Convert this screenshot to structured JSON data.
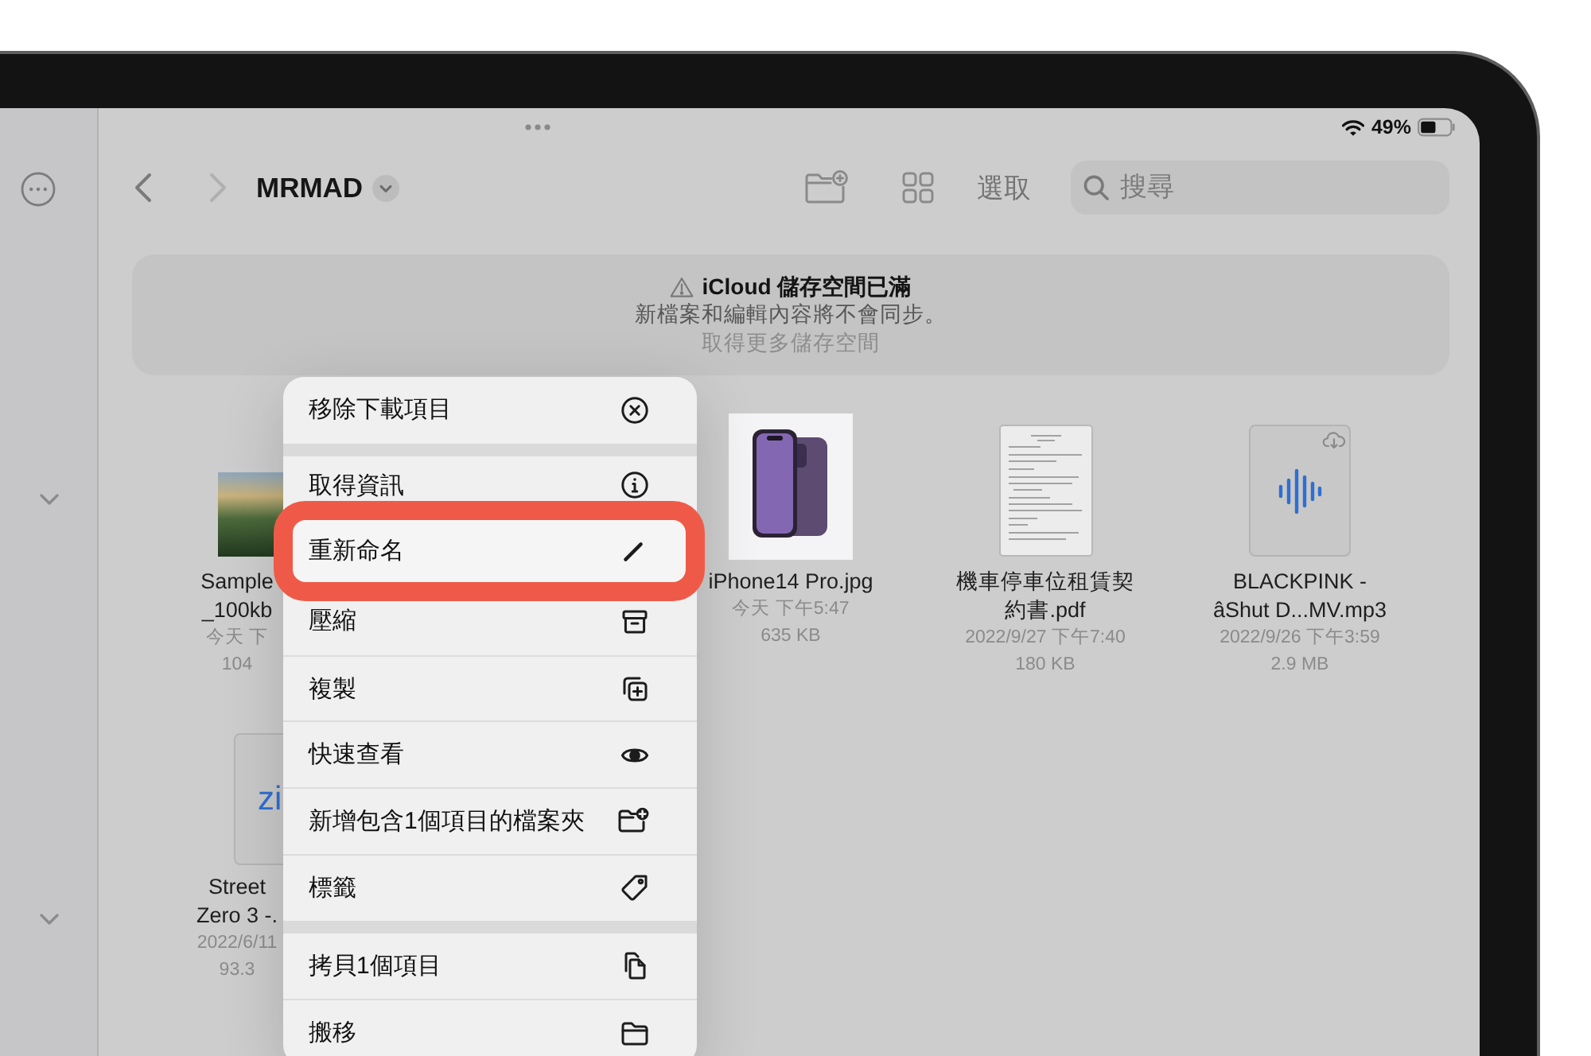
{
  "status_bar": {
    "battery": "49%"
  },
  "toolbar": {
    "back_disabled": false,
    "forward_disabled": true,
    "title": "MRMAD",
    "select_label": "選取",
    "search": {
      "placeholder": "搜尋"
    }
  },
  "banner": {
    "title": "iCloud 儲存空間已滿",
    "message": "新檔案和編輯內容將不會同步。",
    "link": "取得更多儲存空間"
  },
  "file_rows": [
    [
      {
        "kind": "photo",
        "name_lines": [
          "Sample",
          "_100kb"
        ],
        "date": "今天 下",
        "size": "104",
        "cloud": false
      },
      {
        "kind": "image",
        "name_lines": [
          "iPhone14 Pro.jpg"
        ],
        "date": "今天 下午5:47",
        "size": "635 KB",
        "cloud": false
      },
      {
        "kind": "pdf",
        "name_lines": [
          "機車停車位租賃契",
          "約書.pdf"
        ],
        "date": "2022/9/27 下午7:40",
        "size": "180 KB",
        "cloud": false
      },
      {
        "kind": "audio",
        "name_lines": [
          "BLACKPINK -",
          "âShut D...MV.mp3"
        ],
        "date": "2022/9/26 下午3:59",
        "size": "2.9 MB",
        "cloud": true
      }
    ],
    [
      {
        "kind": "zip",
        "type_label": "zi",
        "name_lines": [
          "Street",
          "Zero 3 -."
        ],
        "date": "2022/6/11",
        "size": "93.3",
        "cloud": false
      }
    ]
  ],
  "menu": {
    "groups": [
      {
        "items": [
          {
            "label": "移除下載項目",
            "highlighted": false
          }
        ]
      },
      {
        "items": [
          {
            "label": "取得資訊",
            "highlighted": false
          },
          {
            "label": "重新命名",
            "highlighted": true
          },
          {
            "label": "壓縮",
            "highlighted": false
          },
          {
            "label": "複製",
            "highlighted": false
          },
          {
            "label": "快速查看",
            "highlighted": false
          },
          {
            "label": "新增包含1個項目的檔案夾",
            "highlighted": false
          },
          {
            "label": "標籤",
            "highlighted": false
          }
        ]
      },
      {
        "items": [
          {
            "label": "拷貝1個項目",
            "highlighted": false
          },
          {
            "label": "搬移",
            "highlighted": false
          }
        ]
      }
    ]
  }
}
